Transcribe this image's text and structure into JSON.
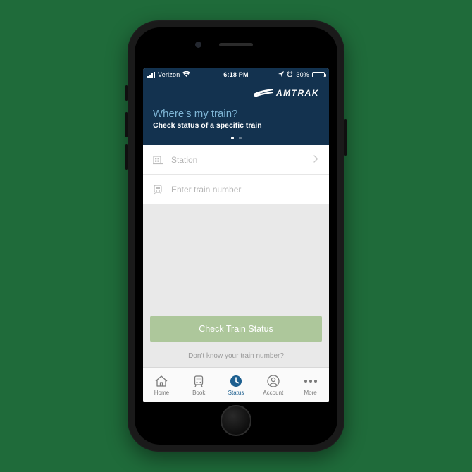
{
  "statusbar": {
    "carrier": "Verizon",
    "time": "6:18 PM",
    "battery_pct": "30%",
    "battery_fill_width": "30%"
  },
  "brand": {
    "name": "AMTRAK"
  },
  "hero": {
    "title": "Where's my train?",
    "subtitle": "Check status of a specific train"
  },
  "form": {
    "station_label": "Station",
    "train_placeholder": "Enter train number"
  },
  "cta": {
    "label": "Check Train Status",
    "hint": "Don't know your train number?"
  },
  "tabs": {
    "home": "Home",
    "book": "Book",
    "status": "Status",
    "account": "Account",
    "more": "More"
  },
  "colors": {
    "header_bg": "#13324f",
    "accent_blue": "#1d5f8f",
    "cta_bg": "#adc79b"
  }
}
